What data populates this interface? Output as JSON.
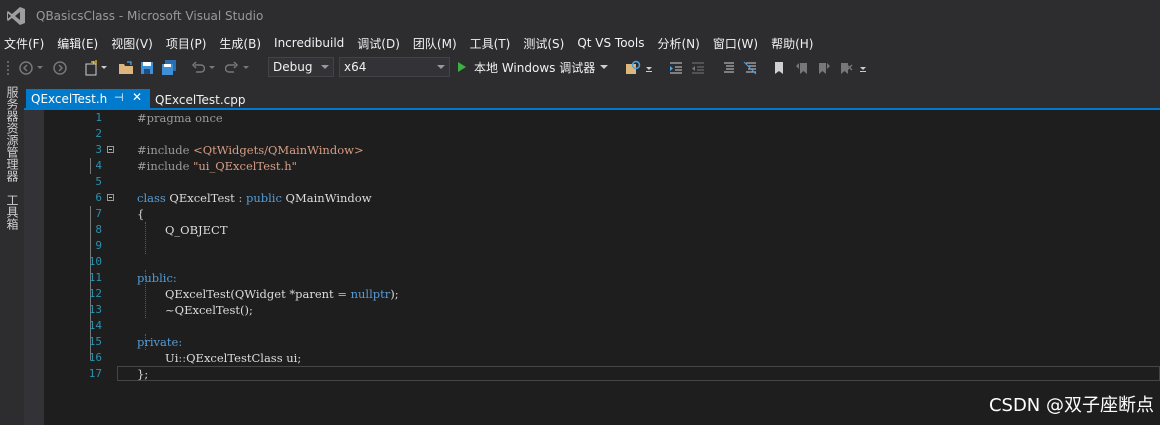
{
  "window": {
    "title": "QBasicsClass - Microsoft Visual Studio"
  },
  "menu": [
    "文件(F)",
    "编辑(E)",
    "视图(V)",
    "项目(P)",
    "生成(B)",
    "Incredibuild",
    "调试(D)",
    "团队(M)",
    "工具(T)",
    "测试(S)",
    "Qt VS Tools",
    "分析(N)",
    "窗口(W)",
    "帮助(H)"
  ],
  "toolbar": {
    "config": "Debug",
    "platform": "x64",
    "run_label": "本地 Windows 调试器",
    "icons": [
      "back-icon",
      "forward-icon",
      "new-project-icon",
      "open-folder-icon",
      "save-icon",
      "save-all-icon",
      "undo-icon",
      "redo-icon",
      "find-icon",
      "indent-icon",
      "outdent-icon",
      "comment-icon",
      "uncomment-icon",
      "bookmark-icon",
      "prev-bookmark-icon",
      "next-bookmark-icon",
      "clear-bookmarks-icon"
    ]
  },
  "sidebar": {
    "server_explorer": "服务器资源管理器",
    "toolbox": "工具箱"
  },
  "tabs": {
    "active": "QExcelTest.h",
    "pin_glyph": "⊣",
    "close_glyph": "✕",
    "inactive": "QExcelTest.cpp"
  },
  "code": {
    "line_numbers": [
      "1",
      "2",
      "3",
      "4",
      "5",
      "6",
      "7",
      "8",
      "9",
      "10",
      "11",
      "12",
      "13",
      "14",
      "15",
      "16",
      "17"
    ],
    "l1": "#pragma once",
    "l3_pp": "#include ",
    "l3_str": "<QtWidgets/QMainWindow>",
    "l4_pp": "#include ",
    "l4_str": "\"ui_QExcelTest.h\"",
    "l6_kw1": "class",
    "l6_name": " QExcelTest ",
    "l6_colon": ":",
    "l6_kw2": " public",
    "l6_base": " QMainWindow",
    "l7": "{",
    "l8": "Q_OBJECT",
    "l11": "public:",
    "l12_a": "QExcelTest(QWidget *parent ",
    "l12_eq": "=",
    "l12_kw": " nullptr",
    "l12_b": ");",
    "l13": "~QExcelTest();",
    "l14": "private:",
    "l15_a": "Ui",
    "l15_op": "::",
    "l15_b": "QExcelTestClass ui;",
    "l16": "};"
  },
  "watermark": "CSDN @双子座断点",
  "colors": {
    "accent": "#007acc",
    "keyword": "#569cd6",
    "string": "#d69d85",
    "line_number": "#2b91af",
    "background": "#1e1e1e",
    "chrome": "#2d2d30"
  }
}
